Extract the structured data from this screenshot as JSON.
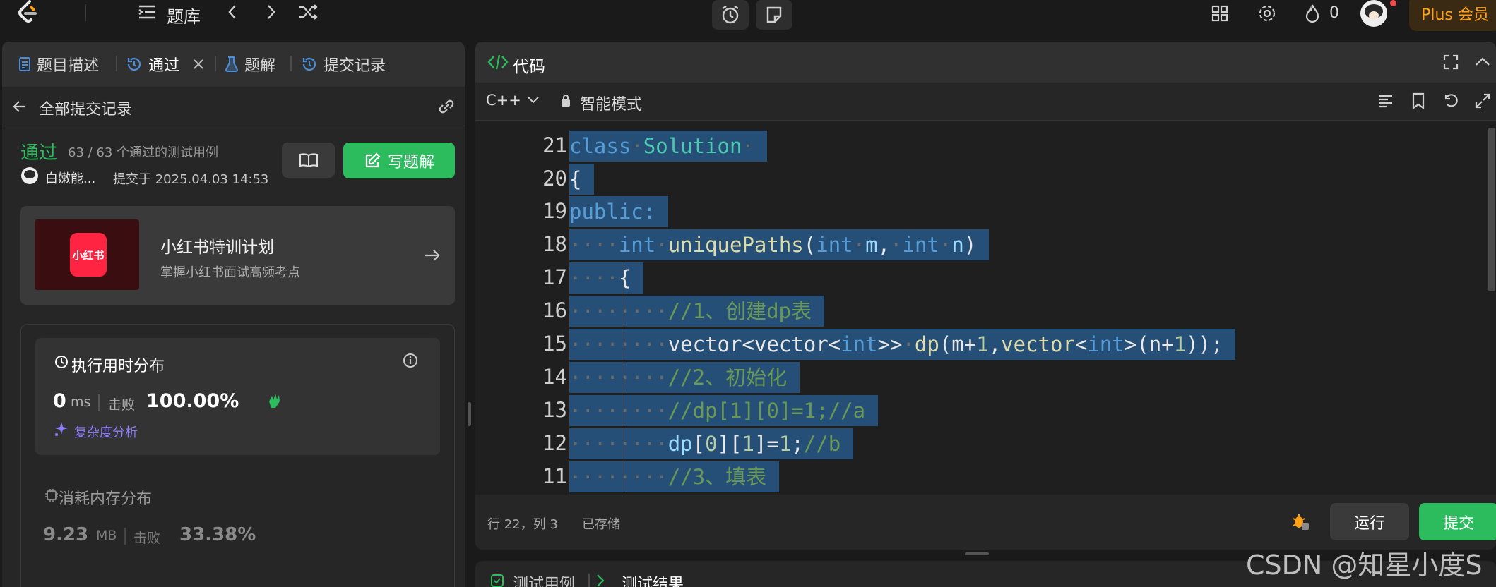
{
  "topbar": {
    "problem_bank": "题库",
    "fire_count": "0",
    "plus_label": "Plus 会员"
  },
  "left_tabs": {
    "description": "题目描述",
    "accepted": "通过",
    "solutions": "题解",
    "submissions": "提交记录"
  },
  "back_label": "全部提交记录",
  "result": {
    "status": "通过",
    "cases": "63 / 63 个通过的测试用例",
    "user": "白嫩能...",
    "submitted_at": "提交于 2025.04.03 14:53",
    "write_solution": "写题解"
  },
  "promo": {
    "logo_text": "小红书",
    "title": "小红书特训计划",
    "subtitle": "掌握小红书面试高频考点"
  },
  "runtime": {
    "title": "执行用时分布",
    "value": "0",
    "unit": "ms",
    "beats_label": "击败",
    "beats_value": "100.00%",
    "complexity": "复杂度分析"
  },
  "memory": {
    "title": "消耗内存分布",
    "value": "9.23",
    "unit": "MB",
    "beats_label": "击败",
    "beats_value": "33.38%"
  },
  "editor": {
    "panel_title": "代码",
    "language": "C++",
    "mode": "智能模式",
    "line_numbers": [
      "21",
      "20",
      "19",
      "18",
      "17",
      "16",
      "15",
      "14",
      "13",
      "12",
      "11"
    ],
    "status_position": "行 22，列 3",
    "status_saved": "已存储",
    "run_label": "运行",
    "submit_label": "提交"
  },
  "bottom_tabs": {
    "testcase": "测试用例",
    "result": "测试结果"
  },
  "watermark": "CSDN @知星小度S",
  "colors": {
    "accent_green": "#2cbb5d",
    "selection": "#264f78",
    "plus_orange": "#ffa116",
    "purple": "#8b7cf6"
  }
}
